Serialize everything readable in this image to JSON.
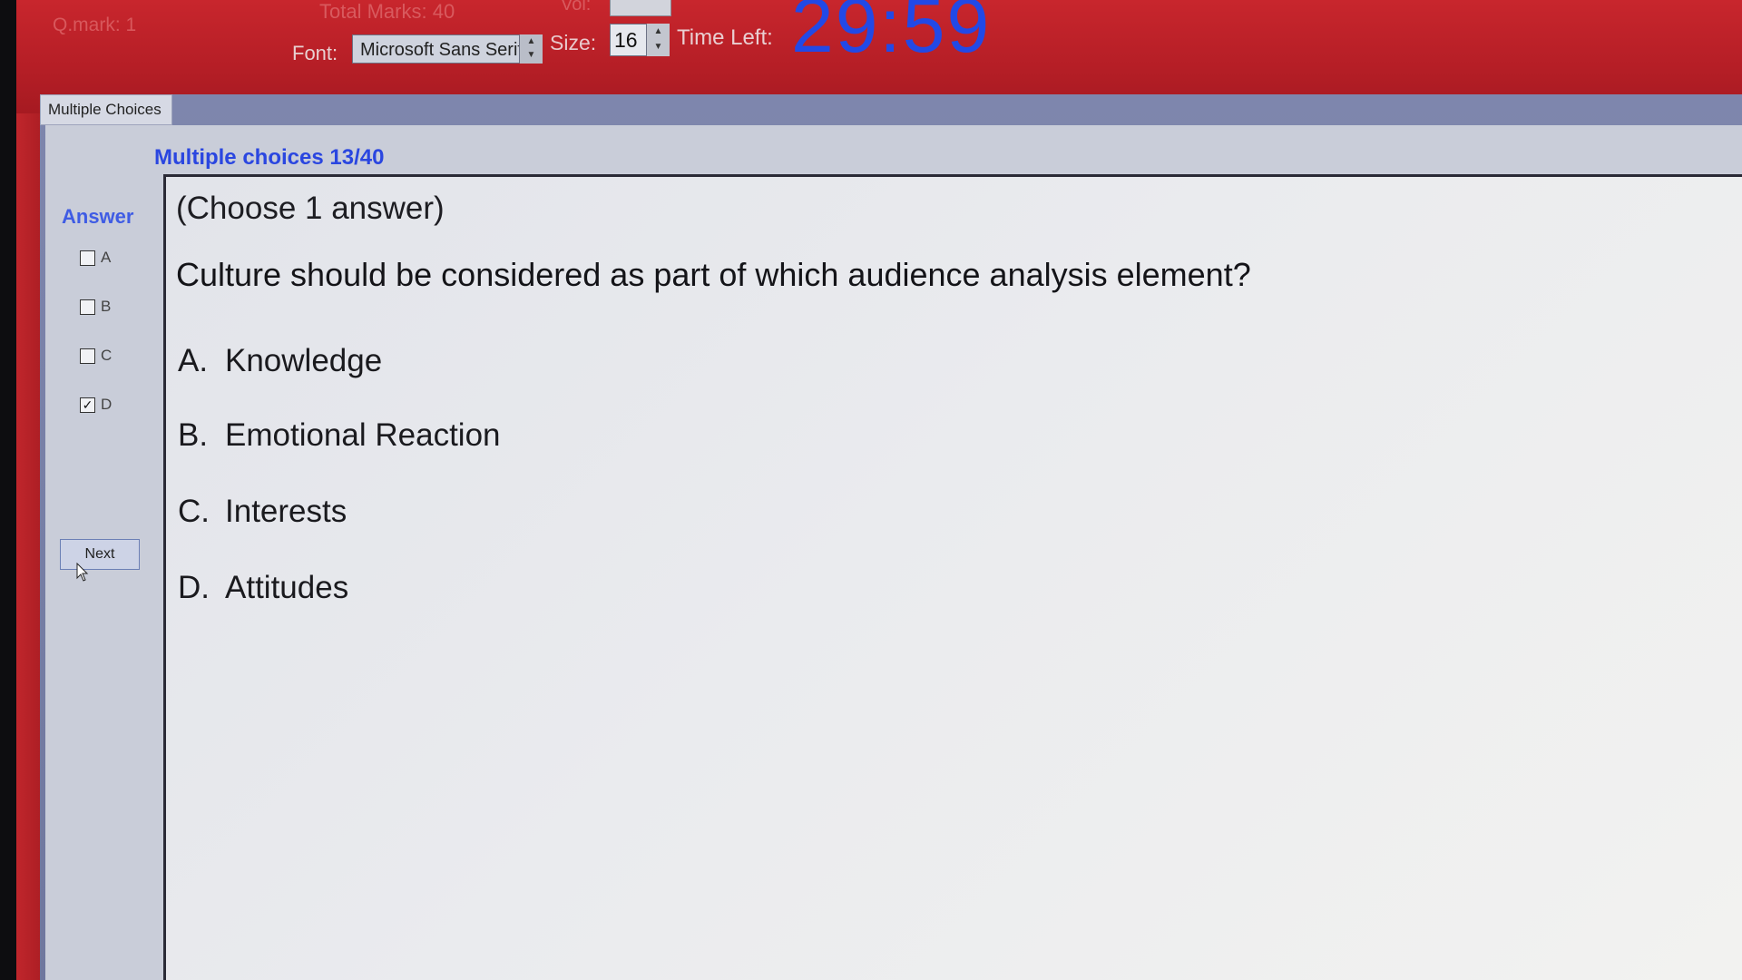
{
  "header": {
    "q_mark_label": "Q.mark:",
    "q_mark_value": "1",
    "total_marks_label": "Total Marks:",
    "total_marks_value": "40",
    "vol_label": "Vol:",
    "font_label": "Font:",
    "font_value": "Microsoft Sans Serif",
    "size_label": "Size:",
    "size_value": "16",
    "time_left_label": "Time Left:",
    "timer": "29:59"
  },
  "tab": {
    "label": "Multiple Choices"
  },
  "main": {
    "section_title": "Multiple choices 13/40",
    "answer_label": "Answer",
    "answers": [
      {
        "letter": "A",
        "checked": false
      },
      {
        "letter": "B",
        "checked": false
      },
      {
        "letter": "C",
        "checked": false
      },
      {
        "letter": "D",
        "checked": true
      }
    ],
    "next_label": "Next",
    "instruction": "(Choose 1 answer)",
    "question": "Culture should be considered as part of which audience analysis element?",
    "choices": [
      {
        "letter": "A.",
        "text": "Knowledge"
      },
      {
        "letter": "B.",
        "text": "Emotional Reaction"
      },
      {
        "letter": "C.",
        "text": "Interests"
      },
      {
        "letter": "D.",
        "text": "Attitudes"
      }
    ]
  },
  "colors": {
    "header_red": "#b51e26",
    "timer_blue": "#2249e6",
    "title_blue": "#2a46e0"
  }
}
